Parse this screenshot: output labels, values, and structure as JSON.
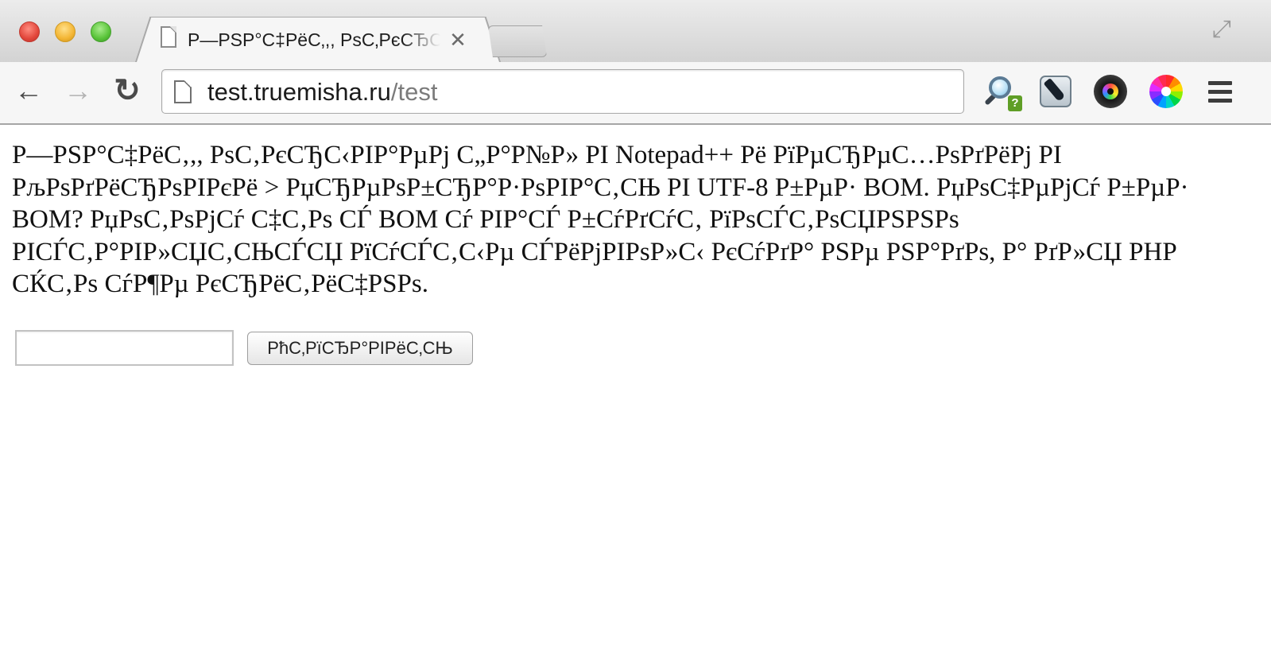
{
  "window": {
    "tab": {
      "title": "Р—РЅР°С‡РёС‚,, РѕС‚РєСЂС",
      "close_glyph": "✕"
    },
    "fullscreen_icon": "fullscreen-arrows-icon"
  },
  "toolbar": {
    "back_glyph": "←",
    "forward_glyph": "→",
    "reload_glyph": "↻",
    "url_host": "test.truemisha.ru",
    "url_path": "/test",
    "extensions": [
      {
        "name": "zoom-help-extension-icon",
        "badge": "?"
      },
      {
        "name": "pen-extension-icon"
      },
      {
        "name": "color-eye-extension-icon"
      },
      {
        "name": "color-wheel-extension-icon"
      }
    ],
    "menu_icon": "hamburger-menu-icon"
  },
  "page": {
    "paragraph": "Р—РЅР°С‡РёС‚,, РѕС‚РєСЂС‹РІР°РµРј С„Р°Р№Р» РІ Notepad++ Рё РїРµСЂРµС…РѕРґРёРј РІ РљРѕРґРёСЂРѕРІРєРё > РџСЂРµРѕР±СЂР°Р·РѕРІР°С‚СЊ РІ UTF-8 Р±РµР· BOM. РџРѕС‡РµРјСѓ Р±РµР· BOM? РџРѕС‚РѕРјСѓ С‡С‚Рѕ СЃ BOM Сѓ РІР°СЃ Р±СѓРґСѓС‚ РїРѕСЃС‚РѕСЏРЅРЅРѕ РІСЃС‚Р°РІР»СЏС‚СЊСЃСЏ РїСѓСЃС‚С‹Рµ СЃРёРјРІРѕР»С‹ РєСѓРґР° РЅРµ РЅР°РґРѕ, Р° РґР»СЏ PHP СЌС‚Рѕ СѓР¶Рµ РєСЂРёС‚РёС‡РЅРѕ.",
    "input_value": "",
    "submit_label": "РћС‚РїСЂР°РІРёС‚СЊ"
  }
}
